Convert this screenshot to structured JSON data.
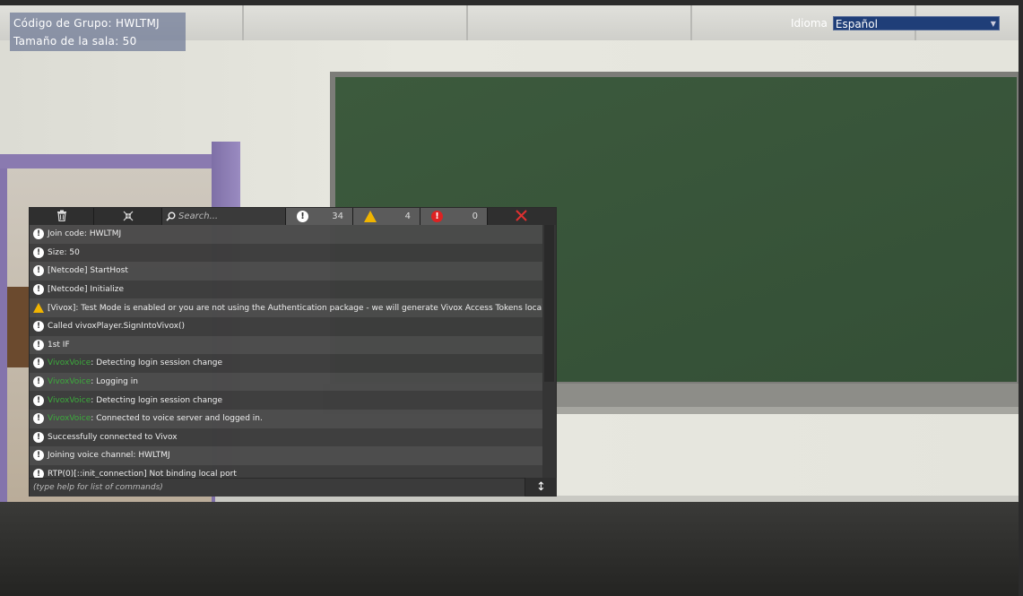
{
  "hud": {
    "group_code": "Código de Grupo: HWLTMJ",
    "room_size": "Tamaño de la sala: 50",
    "language_label": "Idioma",
    "language_value": "Español"
  },
  "console": {
    "search_placeholder": "Search...",
    "info_count": "34",
    "warning_count": "4",
    "error_count": "0",
    "command_placeholder": "(type help for list of commands)",
    "logs": [
      {
        "type": "info",
        "tag": "",
        "text": "Join code: HWLTMJ"
      },
      {
        "type": "info",
        "tag": "",
        "text": "Size: 50"
      },
      {
        "type": "info",
        "tag": "",
        "text": "[Netcode] StartHost"
      },
      {
        "type": "info",
        "tag": "",
        "text": "[Netcode] Initialize"
      },
      {
        "type": "warning",
        "tag": "",
        "text": "[Vivox]: Test Mode is enabled or you are not using the Authentication package - we will generate Vivox Access Tokens locally using your Vivox k"
      },
      {
        "type": "info",
        "tag": "",
        "text": "Called vivoxPlayer.SignIntoVivox()"
      },
      {
        "type": "info",
        "tag": "",
        "text": "1st IF"
      },
      {
        "type": "info",
        "tag": "VivoxVoice",
        "text": ": Detecting login session change"
      },
      {
        "type": "info",
        "tag": "VivoxVoice",
        "text": ": Logging in"
      },
      {
        "type": "info",
        "tag": "VivoxVoice",
        "text": ": Detecting login session change"
      },
      {
        "type": "info",
        "tag": "VivoxVoice",
        "text": ": Connected to voice server and logged in."
      },
      {
        "type": "info",
        "tag": "",
        "text": "Successfully connected to Vivox"
      },
      {
        "type": "info",
        "tag": "",
        "text": "Joining voice channel: HWLTMJ"
      },
      {
        "type": "info",
        "tag": "",
        "text": "RTP(0)[::init_connection] Not binding local port"
      }
    ]
  },
  "icons": {
    "trash": "trash-icon",
    "collapse": "collapse-icon",
    "search": "search-icon",
    "info": "info-icon",
    "warning": "warning-icon",
    "error": "error-icon",
    "close": "close-icon",
    "resize": "resize-icon"
  },
  "colors": {
    "vivox_tag": "#3caa3c",
    "warning": "#f0b400",
    "error": "#dd2222",
    "close": "#e03030",
    "language_select_bg": "#1f3e78",
    "chalkboard": "#3a573b"
  }
}
